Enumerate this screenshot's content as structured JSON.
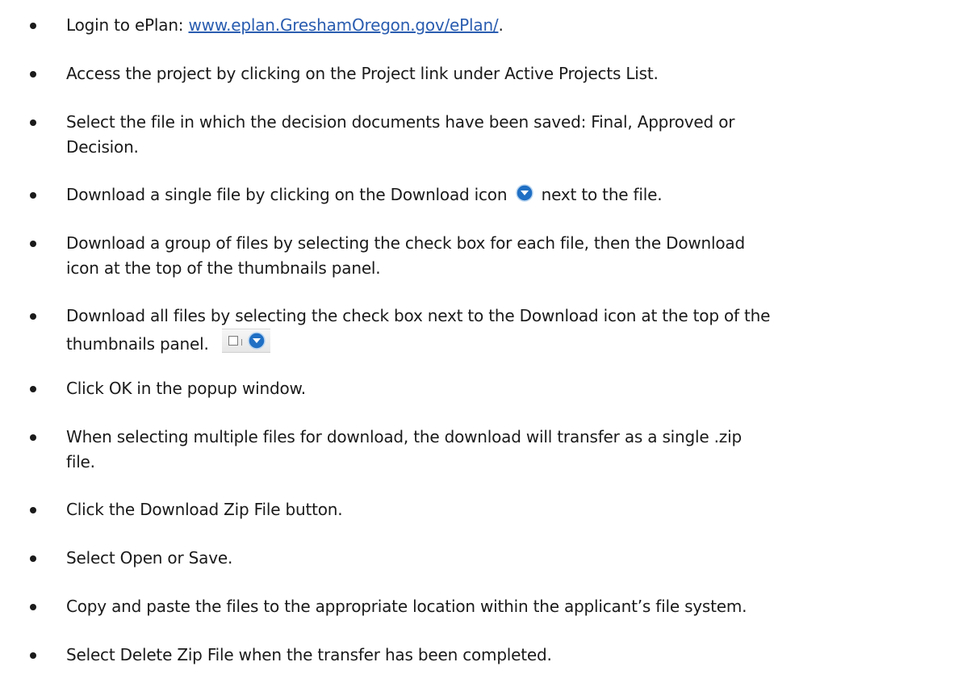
{
  "instructions": [
    {
      "pre": "Login to ePlan: ",
      "link": "www.eplan.GreshamOregon.gov/ePlan/",
      "post": "."
    },
    {
      "lines": [
        "Access the project by clicking on the Project link under Active Projects List."
      ]
    },
    {
      "lines": [
        "Select the file in which the decision documents have been saved: Final, Approved or",
        "Decision."
      ]
    },
    {
      "pre": "Download a single file by clicking on the Download icon",
      "post": "next to the file.",
      "icon": "download-icon"
    },
    {
      "lines": [
        "Download a group of files by selecting the check box for each file, then the Download",
        "icon at the top of the thumbnails panel."
      ]
    },
    {
      "lines": [
        "Download all files by selecting the check box next to the Download icon at the top of the",
        "thumbnails panel."
      ],
      "icon": "checkbox-download-toolbar"
    },
    {
      "lines": [
        "Click OK in the popup window."
      ]
    },
    {
      "lines": [
        "When selecting multiple files for download, the download will transfer as a single .zip",
        "file."
      ]
    },
    {
      "lines": [
        "Click the Download Zip File button."
      ]
    },
    {
      "lines": [
        "Select Open or Save."
      ]
    },
    {
      "lines": [
        "Copy and paste the files to the appropriate location within the applicant’s file system."
      ]
    },
    {
      "lines": [
        "Select Delete Zip File when the transfer has been completed."
      ]
    }
  ],
  "colors": {
    "link": "#2a5db0",
    "icon_blue": "#1f6fc4",
    "text": "#1a1a1a"
  }
}
